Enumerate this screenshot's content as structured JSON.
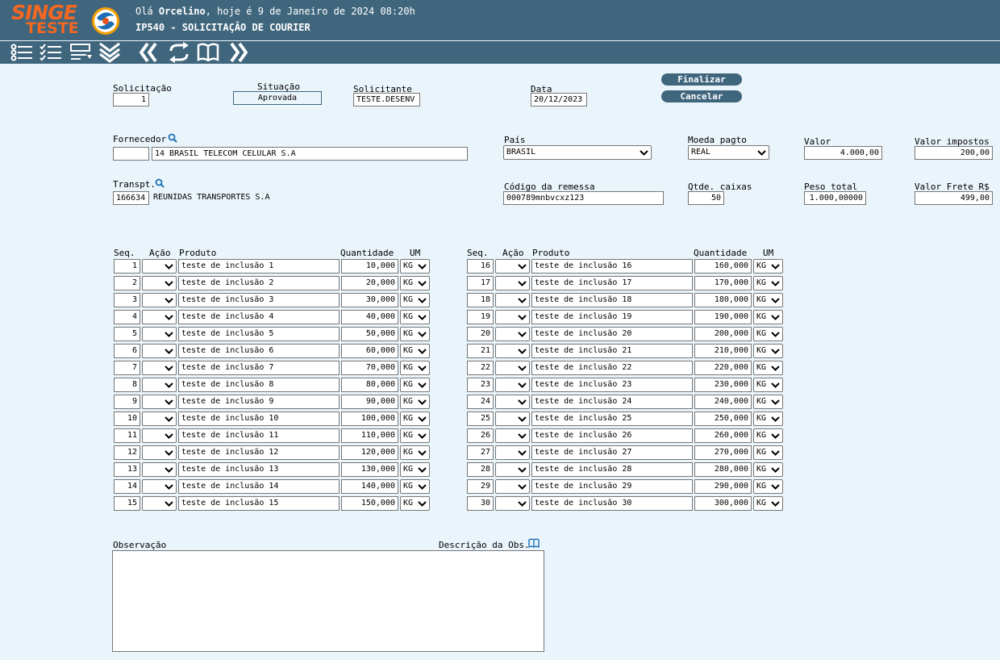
{
  "header": {
    "logo_top": "SINGE",
    "logo_bottom": "TESTE",
    "greeting_prefix": "Olá ",
    "user_name": "Orcelino",
    "greeting_suffix": ", hoje é 9 de Janeiro de 2024 08:20h",
    "screen_title": "IP540 - SOLICITAÇÃO DE COURIER",
    "toolbar_icons": [
      "list-icon",
      "checklist-icon",
      "form-icon",
      "double-chevron-down-icon",
      "first-record-icon",
      "refresh-icon",
      "book-icon",
      "last-record-icon"
    ]
  },
  "form": {
    "solicitacao": {
      "label": "Solicitação",
      "value": "1"
    },
    "situacao": {
      "label": "Situação",
      "value": "Aprovada"
    },
    "solicitante": {
      "label": "Solicitante",
      "value": "TESTE.DESENV"
    },
    "data": {
      "label": "Data",
      "value": "20/12/2023"
    },
    "finalizar_label": "Finalizar",
    "cancelar_label": "Cancelar",
    "fornecedor": {
      "label": "Fornecedor",
      "code": "",
      "name": "14 BRASIL TELECOM CELULAR S.A"
    },
    "pais": {
      "label": "País",
      "value": "BRASIL"
    },
    "moeda": {
      "label": "Moeda pagto",
      "value": "REAL"
    },
    "valor": {
      "label": "Valor",
      "value": "4.000,00"
    },
    "valor_impostos": {
      "label": "Valor impostos",
      "value": "200,00"
    },
    "transp": {
      "label": "Transpt.",
      "code": "166634",
      "name": "REUNIDAS TRANSPORTES S.A"
    },
    "codigo_remessa": {
      "label": "Código da remessa",
      "value": "000789mnbvcxz123"
    },
    "qtde_caixas": {
      "label": "Qtde. caixas",
      "value": "50"
    },
    "peso_total": {
      "label": "Peso total",
      "value": "1.000,00000"
    },
    "valor_frete": {
      "label": "Valor Frete R$",
      "value": "499,00"
    }
  },
  "items_table": {
    "columns": {
      "seq": "Seq.",
      "acao": "Ação",
      "produto": "Produto",
      "quantidade": "Quantidade",
      "um": "UM"
    },
    "left": [
      {
        "seq": "1",
        "acao": "",
        "produto": "teste de inclusão 1",
        "quantidade": "10,000",
        "um": "KG"
      },
      {
        "seq": "2",
        "acao": "",
        "produto": "teste de inclusão 2",
        "quantidade": "20,000",
        "um": "KG"
      },
      {
        "seq": "3",
        "acao": "",
        "produto": "teste de inclusão 3",
        "quantidade": "30,000",
        "um": "KG"
      },
      {
        "seq": "4",
        "acao": "",
        "produto": "teste de inclusão 4",
        "quantidade": "40,000",
        "um": "KG"
      },
      {
        "seq": "5",
        "acao": "",
        "produto": "teste de inclusão 5",
        "quantidade": "50,000",
        "um": "KG"
      },
      {
        "seq": "6",
        "acao": "",
        "produto": "teste de inclusão 6",
        "quantidade": "60,000",
        "um": "KG"
      },
      {
        "seq": "7",
        "acao": "",
        "produto": "teste de inclusão 7",
        "quantidade": "70,000",
        "um": "KG"
      },
      {
        "seq": "8",
        "acao": "",
        "produto": "teste de inclusão 8",
        "quantidade": "80,000",
        "um": "KG"
      },
      {
        "seq": "9",
        "acao": "",
        "produto": "teste de inclusão 9",
        "quantidade": "90,000",
        "um": "KG"
      },
      {
        "seq": "10",
        "acao": "",
        "produto": "teste de inclusão 10",
        "quantidade": "100,000",
        "um": "KG"
      },
      {
        "seq": "11",
        "acao": "",
        "produto": "teste de inclusão 11",
        "quantidade": "110,000",
        "um": "KG"
      },
      {
        "seq": "12",
        "acao": "",
        "produto": "teste de inclusão 12",
        "quantidade": "120,000",
        "um": "KG"
      },
      {
        "seq": "13",
        "acao": "",
        "produto": "teste de inclusão 13",
        "quantidade": "130,000",
        "um": "KG"
      },
      {
        "seq": "14",
        "acao": "",
        "produto": "teste de inclusão 14",
        "quantidade": "140,000",
        "um": "KG"
      },
      {
        "seq": "15",
        "acao": "",
        "produto": "teste de inclusão 15",
        "quantidade": "150,000",
        "um": "KG"
      }
    ],
    "right": [
      {
        "seq": "16",
        "acao": "",
        "produto": "teste de inclusão 16",
        "quantidade": "160,000",
        "um": "KG"
      },
      {
        "seq": "17",
        "acao": "",
        "produto": "teste de inclusão 17",
        "quantidade": "170,000",
        "um": "KG"
      },
      {
        "seq": "18",
        "acao": "",
        "produto": "teste de inclusão 18",
        "quantidade": "180,000",
        "um": "KG"
      },
      {
        "seq": "19",
        "acao": "",
        "produto": "teste de inclusão 19",
        "quantidade": "190,000",
        "um": "KG"
      },
      {
        "seq": "20",
        "acao": "",
        "produto": "teste de inclusão 20",
        "quantidade": "200,000",
        "um": "KG"
      },
      {
        "seq": "21",
        "acao": "",
        "produto": "teste de inclusão 21",
        "quantidade": "210,000",
        "um": "KG"
      },
      {
        "seq": "22",
        "acao": "",
        "produto": "teste de inclusão 22",
        "quantidade": "220,000",
        "um": "KG"
      },
      {
        "seq": "23",
        "acao": "",
        "produto": "teste de inclusão 23",
        "quantidade": "230,000",
        "um": "KG"
      },
      {
        "seq": "24",
        "acao": "",
        "produto": "teste de inclusão 24",
        "quantidade": "240,000",
        "um": "KG"
      },
      {
        "seq": "25",
        "acao": "",
        "produto": "teste de inclusão 25",
        "quantidade": "250,000",
        "um": "KG"
      },
      {
        "seq": "26",
        "acao": "",
        "produto": "teste de inclusão 26",
        "quantidade": "260,000",
        "um": "KG"
      },
      {
        "seq": "27",
        "acao": "",
        "produto": "teste de inclusão 27",
        "quantidade": "270,000",
        "um": "KG"
      },
      {
        "seq": "28",
        "acao": "",
        "produto": "teste de inclusão 28",
        "quantidade": "280,000",
        "um": "KG"
      },
      {
        "seq": "29",
        "acao": "",
        "produto": "teste de inclusão 29",
        "quantidade": "290,000",
        "um": "KG"
      },
      {
        "seq": "30",
        "acao": "",
        "produto": "teste de inclusão 30",
        "quantidade": "300,000",
        "um": "KG"
      }
    ]
  },
  "observacao": {
    "label": "Observação",
    "descricao_label": "Descrição da Obs.",
    "value": ""
  }
}
